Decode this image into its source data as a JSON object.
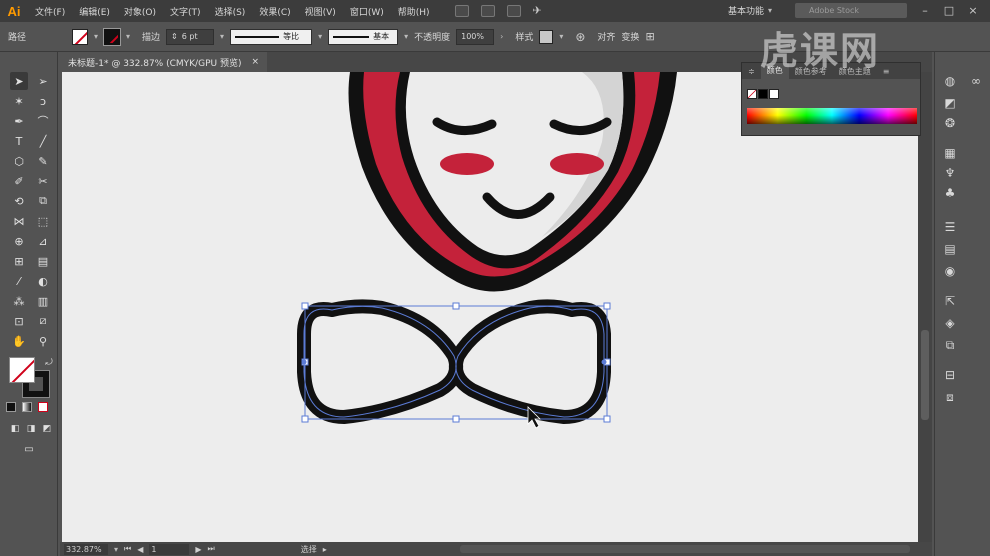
{
  "app": {
    "logo": "Ai",
    "accent": "#ff9a00"
  },
  "menu": [
    "文件(F)",
    "编辑(E)",
    "对象(O)",
    "文字(T)",
    "选择(S)",
    "效果(C)",
    "视图(V)",
    "窗口(W)",
    "帮助(H)"
  ],
  "workspace": {
    "label": "基本功能",
    "search_placeholder": "Adobe Stock"
  },
  "control": {
    "object_type": "路径",
    "stroke_label": "描边",
    "stroke_weight": "6 pt",
    "profile_label": "等比",
    "brush_label": "基本",
    "opacity_label": "不透明度",
    "opacity_value": "100%",
    "style_label": "样式",
    "align_label": "对齐",
    "transform_label": "变换"
  },
  "document": {
    "tab_title": "未标题-1* @ 332.87% (CMYK/GPU 预览)",
    "close": "×"
  },
  "status": {
    "zoom": "332.87%",
    "page": "1",
    "mode": "选择"
  },
  "color_panel": {
    "tabs": [
      "颜色",
      "颜色参考",
      "颜色主题"
    ],
    "active_tab": "颜色"
  },
  "watermark": "虎课网",
  "artwork": {
    "hood_color": "#c4223a",
    "outline_color": "#111111",
    "face_color": "#ececec",
    "shade_color": "#d4d4d4",
    "cheek_color": "#c4223a",
    "selection_color": "#5b7bd5"
  },
  "icons": {
    "tools": [
      "selection-tool-icon",
      "direct-selection-tool-icon",
      "magic-wand-icon",
      "lasso-icon",
      "pen-tool-icon",
      "curvature-tool-icon",
      "type-tool-icon",
      "line-tool-icon",
      "ellipse-tool-icon",
      "brush-tool-icon",
      "shaper-tool-icon",
      "scissors-icon",
      "rotate-tool-icon",
      "scale-tool-icon",
      "width-tool-icon",
      "free-transform-icon",
      "shape-builder-icon",
      "perspective-grid-icon",
      "mesh-tool-icon",
      "gradient-tool-icon",
      "eyedropper-icon",
      "blend-tool-icon",
      "symbol-sprayer-icon",
      "graph-tool-icon",
      "artboard-tool-icon",
      "slice-tool-icon",
      "hand-tool-icon",
      "zoom-tool-icon"
    ]
  }
}
